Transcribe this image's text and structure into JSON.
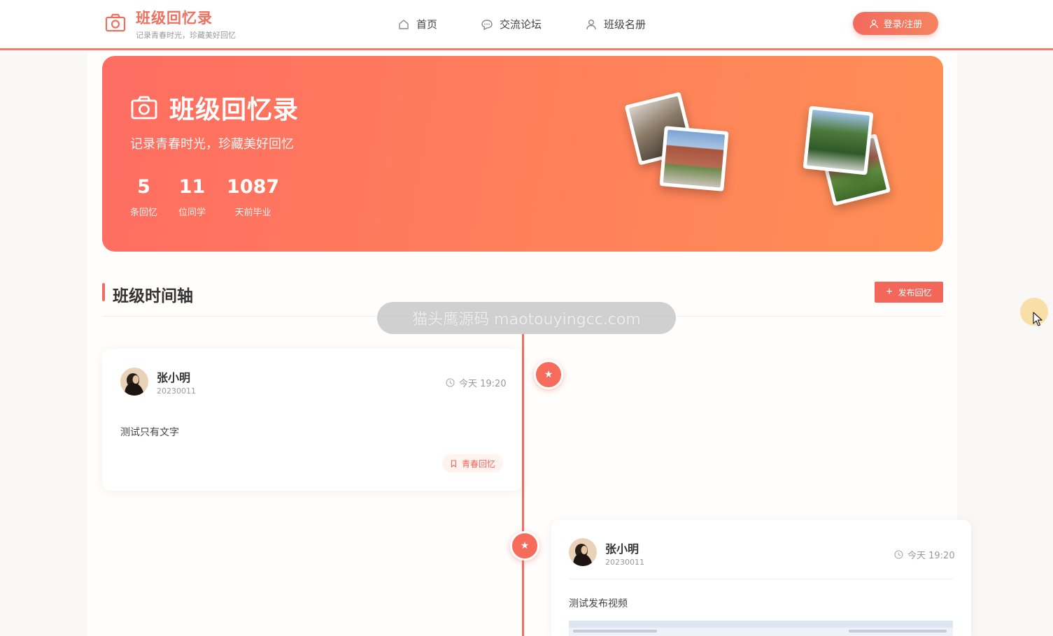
{
  "header": {
    "brand_title": "班级回忆录",
    "brand_subtitle": "记录青春时光，珍藏美好回忆",
    "nav": [
      {
        "label": "首页",
        "icon": "home-icon"
      },
      {
        "label": "交流论坛",
        "icon": "chat-icon"
      },
      {
        "label": "班级名册",
        "icon": "user-icon"
      }
    ],
    "login_label": "登录/注册"
  },
  "hero": {
    "title": "班级回忆录",
    "subtitle": "记录青春时光，珍藏美好回忆",
    "stats": [
      {
        "value": "5",
        "label": "条回忆"
      },
      {
        "value": "11",
        "label": "位同学"
      },
      {
        "value": "1087",
        "label": "天前毕业"
      }
    ]
  },
  "timeline": {
    "title": "班级时间轴",
    "publish_label": "发布回忆",
    "watermark": "猫头鹰源码 maotouyingcc.com",
    "posts": [
      {
        "author": "张小明",
        "student_id": "20230011",
        "time": "今天 19:20",
        "content": "测试只有文字",
        "tag": "青春回忆"
      },
      {
        "author": "张小明",
        "student_id": "20230011",
        "time": "今天 19:20",
        "content": "测试发布视频"
      }
    ]
  },
  "colors": {
    "accent": "#f36a5f",
    "hero_start": "#ff6d62",
    "hero_end": "#ff8f55"
  }
}
